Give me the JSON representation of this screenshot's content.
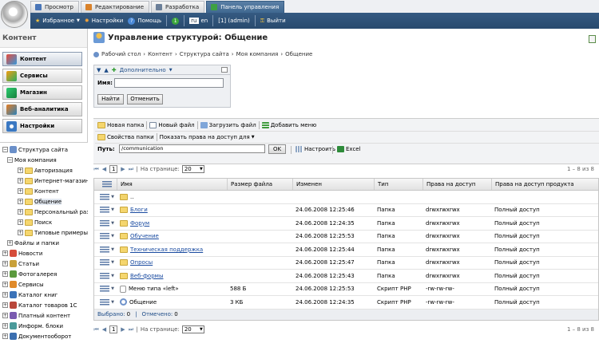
{
  "topbar": {
    "tabs": [
      {
        "label": "Просмотр"
      },
      {
        "label": "Редактирование"
      },
      {
        "label": "Разработка"
      },
      {
        "label": "Панель управления"
      }
    ],
    "favorites": "Избранное",
    "settings": "Настройки",
    "help": "Помощь",
    "lang_ru": "ru",
    "lang_en": "en",
    "user": "[1] (admin)",
    "logout": "Выйти"
  },
  "sidebar": {
    "title": "Контент",
    "buttons": [
      {
        "label": "Контент"
      },
      {
        "label": "Сервисы"
      },
      {
        "label": "Магазин"
      },
      {
        "label": "Веб-аналитика"
      },
      {
        "label": "Настройки"
      }
    ],
    "tree": [
      {
        "label": "Структура сайта"
      },
      {
        "label": "Моя компания"
      },
      {
        "label": "Авторизация"
      },
      {
        "label": "Интернет-магазин"
      },
      {
        "label": "Контент"
      },
      {
        "label": "Общение"
      },
      {
        "label": "Персональный раз"
      },
      {
        "label": "Поиск"
      },
      {
        "label": "Типовые примеры"
      },
      {
        "label": "Файлы и папки"
      },
      {
        "label": "Новости"
      },
      {
        "label": "Статьи"
      },
      {
        "label": "Фотогалерея"
      },
      {
        "label": "Сервисы"
      },
      {
        "label": "Каталог книг"
      },
      {
        "label": "Каталог товаров 1С"
      },
      {
        "label": "Платный контент"
      },
      {
        "label": "Информ. блоки"
      },
      {
        "label": "Документооборот"
      }
    ]
  },
  "page": {
    "title": "Управление структурой: Общение",
    "breadcrumb": [
      "Рабочий стол",
      "Контент",
      "Структура сайта",
      "Моя компания",
      "Общение"
    ]
  },
  "filter": {
    "add": "Дополнительно",
    "name_label": "Имя:",
    "name_value": "",
    "find": "Найти",
    "cancel": "Отменить"
  },
  "toolbar": {
    "new_folder": "Новая папка",
    "new_file": "Новый файл",
    "upload": "Загрузить файл",
    "add_menu": "Добавить меню",
    "folder_props": "Свойства папки",
    "show_rights": "Показать права на доступ для",
    "path_label": "Путь:",
    "path_value": "/communication",
    "ok": "OK",
    "configure": "Настроить",
    "excel": "Excel"
  },
  "pager": {
    "page": "1",
    "per_page_label": "На странице:",
    "per_page": "20",
    "count": "1 – 8 из 8"
  },
  "grid": {
    "columns": [
      "Имя",
      "Размер файла",
      "Изменен",
      "Тип",
      "Права на доступ",
      "Права на доступ продукта"
    ],
    "up": "..",
    "rows": [
      {
        "name": "Блоги",
        "size": "",
        "modified": "24.06.2008 12:25:46",
        "type": "Папка",
        "rights": "drwxrwxrwx",
        "product": "Полный доступ",
        "kind": "folder"
      },
      {
        "name": "Форум",
        "size": "",
        "modified": "24.06.2008 12:24:35",
        "type": "Папка",
        "rights": "drwxrwxrwx",
        "product": "Полный доступ",
        "kind": "folder"
      },
      {
        "name": "Обучение",
        "size": "",
        "modified": "24.06.2008 12:25:53",
        "type": "Папка",
        "rights": "drwxrwxrwx",
        "product": "Полный доступ",
        "kind": "folder"
      },
      {
        "name": "Техническая поддержка",
        "size": "",
        "modified": "24.06.2008 12:25:44",
        "type": "Папка",
        "rights": "drwxrwxrwx",
        "product": "Полный доступ",
        "kind": "folder"
      },
      {
        "name": "Опросы",
        "size": "",
        "modified": "24.06.2008 12:25:47",
        "type": "Папка",
        "rights": "drwxrwxrwx",
        "product": "Полный доступ",
        "kind": "folder"
      },
      {
        "name": "Веб-формы",
        "size": "",
        "modified": "24.06.2008 12:25:43",
        "type": "Папка",
        "rights": "drwxrwxrwx",
        "product": "Полный доступ",
        "kind": "folder"
      },
      {
        "name": "Меню типа «left»",
        "size": "588 Б",
        "modified": "24.06.2008 12:25:53",
        "type": "Скрипт PHP",
        "rights": "-rw-rw-rw-",
        "product": "Полный доступ",
        "kind": "file"
      },
      {
        "name": "Общение",
        "size": "3 КБ",
        "modified": "24.06.2008 12:24:35",
        "type": "Скрипт PHP",
        "rights": "-rw-rw-rw-",
        "product": "Полный доступ",
        "kind": "page"
      }
    ],
    "selected_label": "Выбрано:",
    "selected": "0",
    "marked_label": "Отмечено:",
    "marked": "0"
  }
}
